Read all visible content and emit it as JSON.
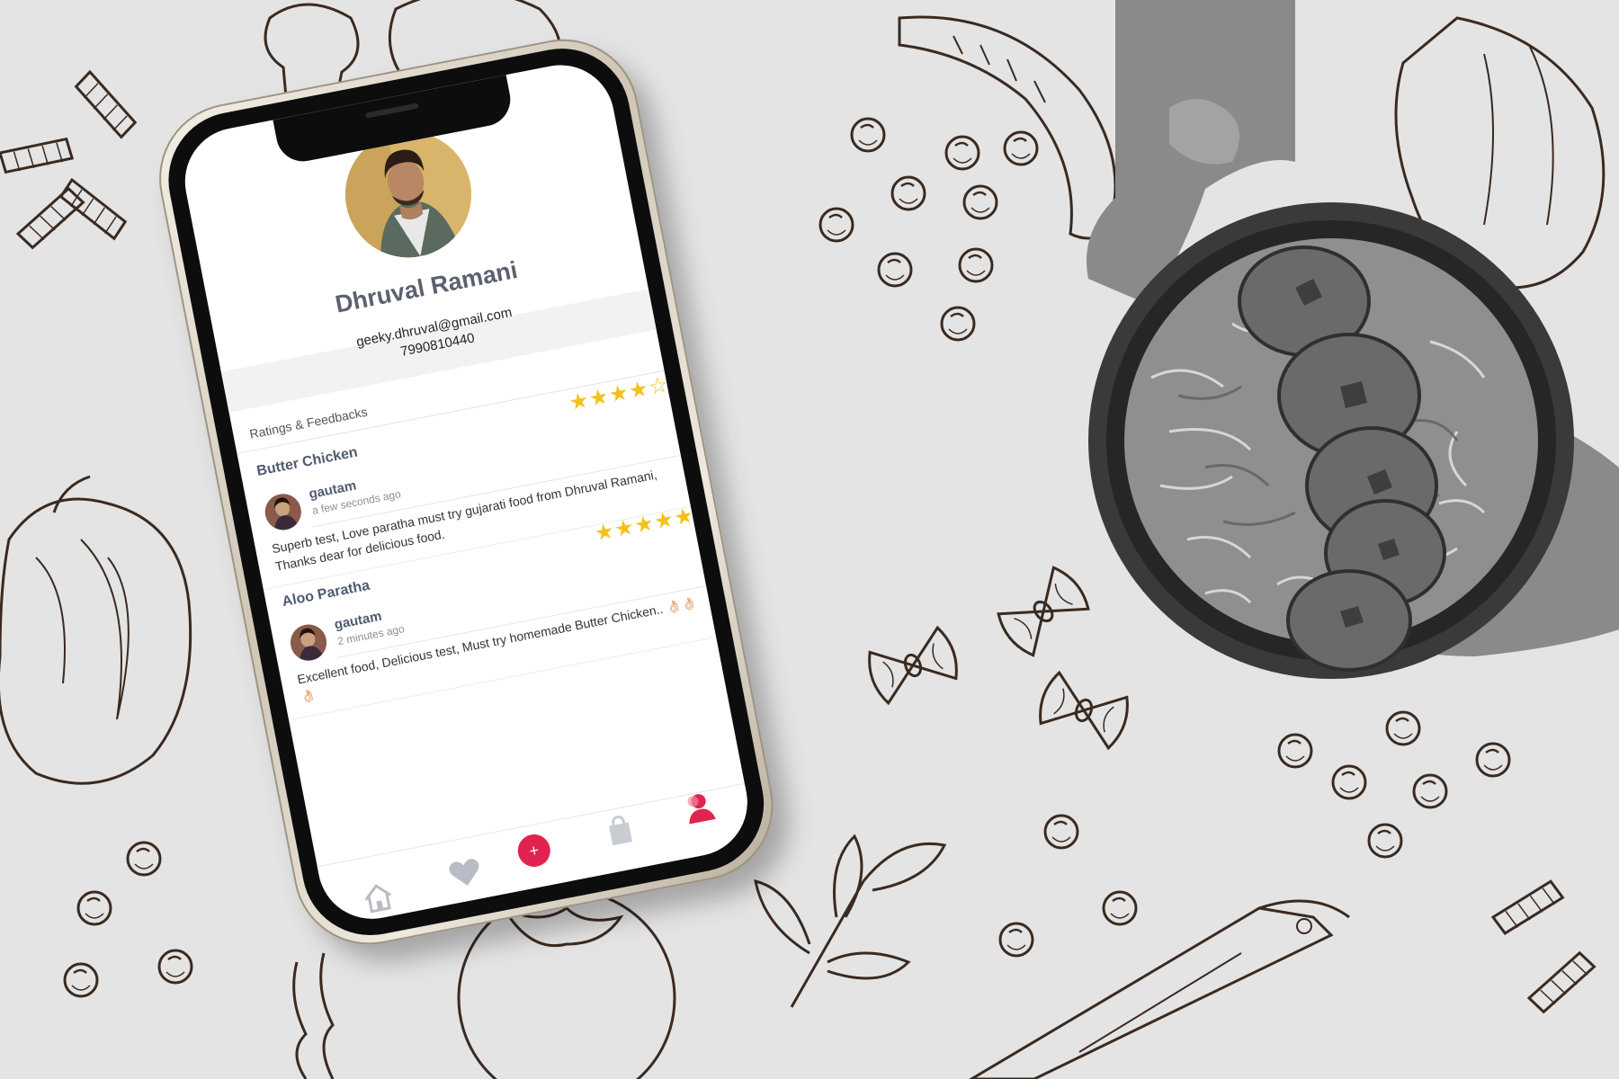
{
  "profile": {
    "name": "Dhruval Ramani",
    "email": "geeky.dhruval@gmail.com",
    "phone": "7990810440"
  },
  "section": {
    "title": "Ratings & Feedbacks"
  },
  "reviews": [
    {
      "dish": "Butter Chicken",
      "stars": 4,
      "stars_display": "★★★★☆",
      "user": "gautam",
      "time": "a few seconds ago",
      "text": "Superb test, Love paratha must try gujarati food from Dhruval Ramani, Thanks dear for delicious food."
    },
    {
      "dish": "Aloo Paratha",
      "stars": 5,
      "stars_display": "★★★★★",
      "user": "gautam",
      "time": "2 minutes ago",
      "text": "Excellent food, Delicious test, Must try homemade Butter Chicken.. 👌🏻👌🏻👌🏻"
    }
  ],
  "nav": {
    "items": [
      "home-icon",
      "heart-icon",
      "add-icon",
      "bag-icon",
      "profile-icon"
    ],
    "add_label": "+",
    "active": "profile-icon"
  },
  "colors": {
    "accent": "#e0244f",
    "star": "#f2c21b",
    "name_text": "#5c6170",
    "dish_text": "#4f5a72"
  }
}
